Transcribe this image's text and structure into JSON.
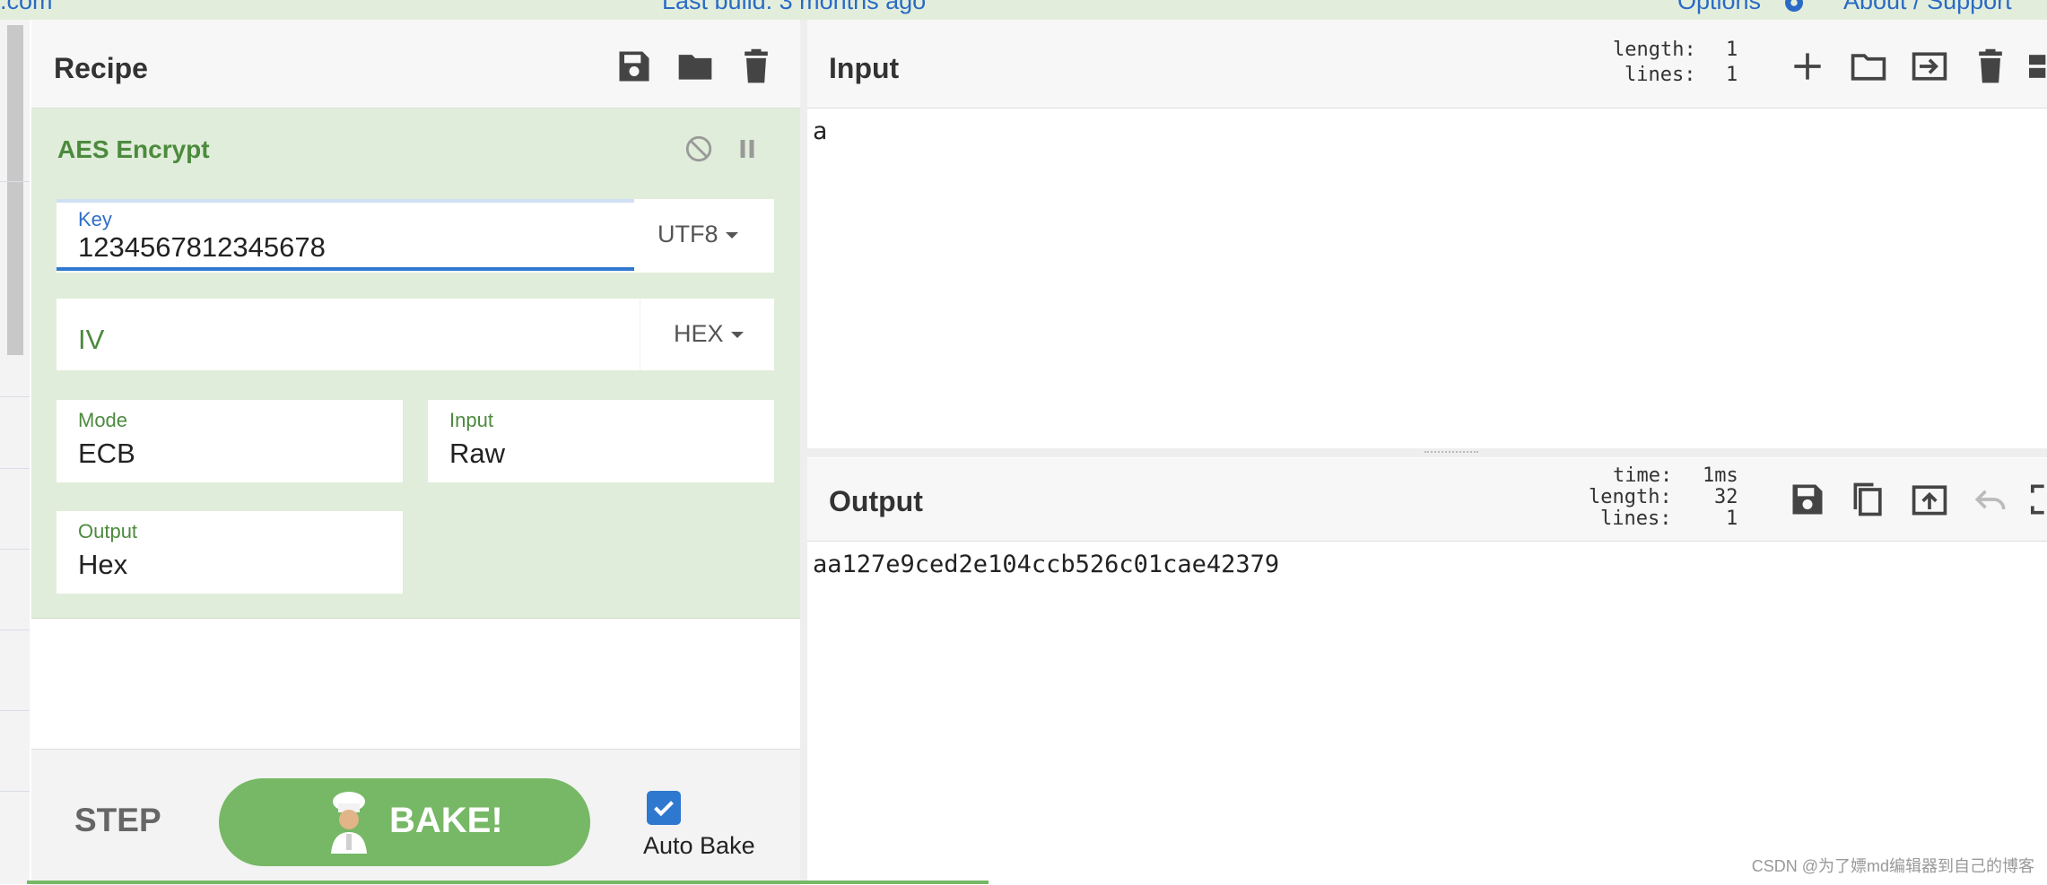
{
  "topbar": {
    "site_fragment": ".com",
    "last_build": "Last build: 3 months ago",
    "options": "Options",
    "about": "About / Support"
  },
  "recipe": {
    "title": "Recipe",
    "operation": {
      "name": "AES Encrypt",
      "key": {
        "label": "Key",
        "value": "1234567812345678",
        "encoding": "UTF8"
      },
      "iv": {
        "placeholder": "IV",
        "encoding": "HEX"
      },
      "mode": {
        "label": "Mode",
        "value": "ECB"
      },
      "input": {
        "label": "Input",
        "value": "Raw"
      },
      "output": {
        "label": "Output",
        "value": "Hex"
      }
    },
    "controls": {
      "step": "STEP",
      "bake": "BAKE!",
      "auto_bake": "Auto Bake",
      "auto_bake_checked": true
    }
  },
  "input": {
    "title": "Input",
    "stats": {
      "length_label": "length:",
      "length": "1",
      "lines_label": "lines:",
      "lines": "1"
    },
    "text": "a"
  },
  "output": {
    "title": "Output",
    "stats": {
      "time_label": "time:",
      "time": "1ms",
      "length_label": "length:",
      "length": "32",
      "lines_label": "lines:",
      "lines": "1"
    },
    "text": "aa127e9ced2e104ccb526c01cae42379"
  },
  "watermark": "CSDN @为了嫖md编辑器到自己的博客",
  "colors": {
    "accent_green": "#76b865",
    "op_bg": "#e0edda",
    "label_green": "#4c8a3e",
    "link_blue": "#2a6ac6",
    "focus_blue": "#2f78d0"
  }
}
